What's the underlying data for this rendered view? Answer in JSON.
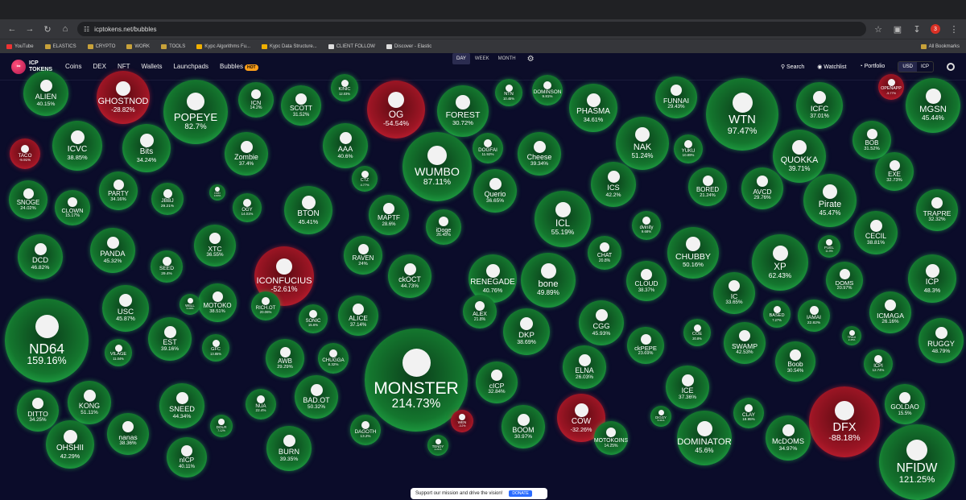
{
  "browser": {
    "url": "icptokens.net/bubbles",
    "bookmarks": [
      "YouTube",
      "ELASTICS",
      "CRYPTO",
      "WORK",
      "TOOLS",
      "Kypc Algorithms Fu...",
      "Kypc Data Structure...",
      "CLIENT FOLLOW",
      "Discover - Elastic"
    ],
    "all_bookmarks": "All Bookmarks",
    "profile_initial": "3"
  },
  "app": {
    "logo_line1": "ICP",
    "logo_line2": "TOKENS",
    "nav": [
      "Coins",
      "DEX",
      "NFT",
      "Wallets",
      "Launchpads",
      "Bubbles"
    ],
    "hot_badge": "HOT",
    "search": "Search",
    "watchlist": "Watchlist",
    "portfolio": "Portfolio",
    "currencies": [
      "USD",
      "ICP"
    ],
    "selected_currency": "USD"
  },
  "period": {
    "options": [
      "DAY",
      "WEEK",
      "MONTH"
    ],
    "selected": "DAY"
  },
  "colors": {
    "positive": "#2bd15a",
    "negative": "#e0283a",
    "background": "#0b0c2a"
  },
  "bubbles": [
    {
      "name": "ALIEN",
      "pct": "40.15%",
      "trend": "up"
    },
    {
      "name": "GHOSTNOD",
      "pct": "-28.82%",
      "trend": "down"
    },
    {
      "name": "POPEYE",
      "pct": "82.7%",
      "trend": "up"
    },
    {
      "name": "ICN",
      "pct": "14.2%",
      "trend": "up"
    },
    {
      "name": "SCOTT",
      "pct": "31.52%",
      "trend": "up"
    },
    {
      "name": "KINIC",
      "pct": "12.03%",
      "trend": "up"
    },
    {
      "name": "OG",
      "pct": "-54.54%",
      "trend": "down"
    },
    {
      "name": "FOREST",
      "pct": "30.72%",
      "trend": "up"
    },
    {
      "name": "NTN",
      "pct": "10.45%",
      "trend": "up"
    },
    {
      "name": "DOMINSON",
      "pct": "9.81%",
      "trend": "up"
    },
    {
      "name": "PHASMA",
      "pct": "34.61%",
      "trend": "up"
    },
    {
      "name": "FUNNAI",
      "pct": "29.43%",
      "trend": "up"
    },
    {
      "name": "WTN",
      "pct": "97.47%",
      "trend": "up"
    },
    {
      "name": "ICFC",
      "pct": "37.01%",
      "trend": "up"
    },
    {
      "name": "OPENAPP",
      "pct": "-5.77%",
      "trend": "down"
    },
    {
      "name": "MGSN",
      "pct": "45.44%",
      "trend": "up"
    },
    {
      "name": "TACO",
      "pct": "-9.91%",
      "trend": "down"
    },
    {
      "name": "ICVC",
      "pct": "38.85%",
      "trend": "up"
    },
    {
      "name": "Bits",
      "pct": "34.24%",
      "trend": "up"
    },
    {
      "name": "Zombie",
      "pct": "37.4%",
      "trend": "up"
    },
    {
      "name": "AAA",
      "pct": "40.6%",
      "trend": "up"
    },
    {
      "name": "WUMBO",
      "pct": "87.11%",
      "trend": "up"
    },
    {
      "name": "DOGFAI",
      "pct": "11.92%",
      "trend": "up"
    },
    {
      "name": "Cheese",
      "pct": "39.34%",
      "trend": "up"
    },
    {
      "name": "NAK",
      "pct": "51.24%",
      "trend": "up"
    },
    {
      "name": "YUKU",
      "pct": "10.89%",
      "trend": "up"
    },
    {
      "name": "BOB",
      "pct": "31.52%",
      "trend": "up"
    },
    {
      "name": "QUOKKA",
      "pct": "39.71%",
      "trend": "up"
    },
    {
      "name": "EXE",
      "pct": "32.73%",
      "trend": "up"
    },
    {
      "name": "SNOGE",
      "pct": "24.02%",
      "trend": "up"
    },
    {
      "name": "CLOWN",
      "pct": "15.17%",
      "trend": "up"
    },
    {
      "name": "PARTY",
      "pct": "34.16%",
      "trend": "up"
    },
    {
      "name": "JBBJ",
      "pct": "29.21%",
      "trend": "up"
    },
    {
      "name": "OGY",
      "pct": "14.01%",
      "trend": "up"
    },
    {
      "name": "BTON",
      "pct": "45.41%",
      "trend": "up"
    },
    {
      "name": "CTZ",
      "pct": "4.77%",
      "trend": "up"
    },
    {
      "name": "Querio",
      "pct": "36.65%",
      "trend": "up"
    },
    {
      "name": "ICS",
      "pct": "42.2%",
      "trend": "up"
    },
    {
      "name": "BORED",
      "pct": "21.24%",
      "trend": "up"
    },
    {
      "name": "AVCD",
      "pct": "29.76%",
      "trend": "up"
    },
    {
      "name": "Pirate",
      "pct": "45.47%",
      "trend": "up"
    },
    {
      "name": "TRAPRE",
      "pct": "32.32%",
      "trend": "up"
    },
    {
      "name": "DCD",
      "pct": "46.82%",
      "trend": "up"
    },
    {
      "name": "PANDA",
      "pct": "45.32%",
      "trend": "up"
    },
    {
      "name": "XTC",
      "pct": "36.55%",
      "trend": "up"
    },
    {
      "name": "SEED",
      "pct": "29.4%",
      "trend": "up"
    },
    {
      "name": "MAPTF",
      "pct": "28.6%",
      "trend": "up"
    },
    {
      "name": "iDoge",
      "pct": "26.45%",
      "trend": "up"
    },
    {
      "name": "ICL",
      "pct": "55.19%",
      "trend": "up"
    },
    {
      "name": "dvinity",
      "pct": "9.68%",
      "trend": "up"
    },
    {
      "name": "CHUBBY",
      "pct": "50.16%",
      "trend": "up"
    },
    {
      "name": "XP",
      "pct": "62.43%",
      "trend": "up"
    },
    {
      "name": "CECIL",
      "pct": "38.81%",
      "trend": "up"
    },
    {
      "name": "ICONFUCIUS",
      "pct": "-52.61%",
      "trend": "down"
    },
    {
      "name": "RAVEN",
      "pct": "24%",
      "trend": "up"
    },
    {
      "name": "ckOCT",
      "pct": "44.73%",
      "trend": "up"
    },
    {
      "name": "RENEGADE",
      "pct": "40.76%",
      "trend": "up"
    },
    {
      "name": "CHAT",
      "pct": "20.8%",
      "trend": "up"
    },
    {
      "name": "FUEL",
      "pct": "11.9%",
      "trend": "up"
    },
    {
      "name": "ICP",
      "pct": "48.3%",
      "trend": "up"
    },
    {
      "name": "ND64",
      "pct": "159.16%",
      "trend": "up"
    },
    {
      "name": "USC",
      "pct": "45.87%",
      "trend": "up"
    },
    {
      "name": "MOTOKO",
      "pct": "38.51%",
      "trend": "up"
    },
    {
      "name": "bone",
      "pct": "49.89%",
      "trend": "up"
    },
    {
      "name": "CLOUD",
      "pct": "38.37%",
      "trend": "up"
    },
    {
      "name": "IC",
      "pct": "33.65%",
      "trend": "up"
    },
    {
      "name": "DOMS",
      "pct": "20.97%",
      "trend": "up"
    },
    {
      "name": "RICH.OT",
      "pct": "20.06%",
      "trend": "up"
    },
    {
      "name": "SONIC",
      "pct": "15.6%",
      "trend": "up"
    },
    {
      "name": "ALICE",
      "pct": "37.14%",
      "trend": "up"
    },
    {
      "name": "ALEX",
      "pct": "21.8%",
      "trend": "up"
    },
    {
      "name": "CGG",
      "pct": "45.93%",
      "trend": "up"
    },
    {
      "name": "BASED",
      "pct": "7.27%",
      "trend": "up"
    },
    {
      "name": "IAMAI",
      "pct": "22.82%",
      "trend": "up"
    },
    {
      "name": "ICMAGA",
      "pct": "26.16%",
      "trend": "up"
    },
    {
      "name": "VILAGE",
      "pct": "11.04%",
      "trend": "up"
    },
    {
      "name": "EST",
      "pct": "39.16%",
      "trend": "up"
    },
    {
      "name": "GFC",
      "pct": "13.85%",
      "trend": "up"
    },
    {
      "name": "AWB",
      "pct": "29.29%",
      "trend": "up"
    },
    {
      "name": "CHUGGA",
      "pct": "8.32%",
      "trend": "up"
    },
    {
      "name": "MONSTER",
      "pct": "214.73%",
      "trend": "up"
    },
    {
      "name": "DKP",
      "pct": "38.69%",
      "trend": "up"
    },
    {
      "name": "ckPEPE",
      "pct": "23.69%",
      "trend": "up"
    },
    {
      "name": "COE",
      "pct": "20.8%",
      "trend": "up"
    },
    {
      "name": "SWAMP",
      "pct": "42.53%",
      "trend": "up"
    },
    {
      "name": "TRAX",
      "pct": "2.45%",
      "trend": "up"
    },
    {
      "name": "RUGGY",
      "pct": "48.79%",
      "trend": "up"
    },
    {
      "name": "DITTO",
      "pct": "34.25%",
      "trend": "up"
    },
    {
      "name": "KONG",
      "pct": "51.11%",
      "trend": "up"
    },
    {
      "name": "SNEED",
      "pct": "44.34%",
      "trend": "up"
    },
    {
      "name": "NUA",
      "pct": "22.4%",
      "trend": "up"
    },
    {
      "name": "BAD.OT",
      "pct": "50.32%",
      "trend": "up"
    },
    {
      "name": "cICP",
      "pct": "32.84%",
      "trend": "up"
    },
    {
      "name": "ELNA",
      "pct": "26.03%",
      "trend": "up"
    },
    {
      "name": "ICE",
      "pct": "37.36%",
      "trend": "up"
    },
    {
      "name": "Boob",
      "pct": "30.54%",
      "trend": "up"
    },
    {
      "name": "ICPI",
      "pct": "12.74%",
      "trend": "up"
    },
    {
      "name": "CLAY",
      "pct": "18.95%",
      "trend": "up"
    },
    {
      "name": "GOLDAO",
      "pct": "15.5%",
      "trend": "up"
    },
    {
      "name": "DOLR",
      "pct": "7.12%",
      "trend": "up"
    },
    {
      "name": "DAGOTH",
      "pct": "13.2%",
      "trend": "up"
    },
    {
      "name": "WEN",
      "pct": "-3.2%",
      "trend": "down"
    },
    {
      "name": "COW",
      "pct": "-32.26%",
      "trend": "down"
    },
    {
      "name": "DIGGY",
      "pct": "6.31%",
      "trend": "up"
    },
    {
      "name": "DFX",
      "pct": "-88.18%",
      "trend": "down"
    },
    {
      "name": "OHSHII",
      "pct": "42.29%",
      "trend": "up"
    },
    {
      "name": "nanas",
      "pct": "38.36%",
      "trend": "up"
    },
    {
      "name": "nICP",
      "pct": "40.11%",
      "trend": "up"
    },
    {
      "name": "BURN",
      "pct": "39.35%",
      "trend": "up"
    },
    {
      "name": "BOOM",
      "pct": "30.97%",
      "trend": "up"
    },
    {
      "name": "MOTOKOINS",
      "pct": "14.25%",
      "trend": "up"
    },
    {
      "name": "DOMINATOR",
      "pct": "45.6%",
      "trend": "up"
    },
    {
      "name": "McDOMS",
      "pct": "34.97%",
      "trend": "up"
    },
    {
      "name": "NFIDW",
      "pct": "121.25%",
      "trend": "up"
    },
    {
      "name": "TENDY",
      "pct": "2.21%",
      "trend": "up"
    },
    {
      "name": "WELL",
      "pct": "6.09%",
      "trend": "up"
    },
    {
      "name": "DOD",
      "pct": "3.83%",
      "trend": "up"
    }
  ],
  "toast": {
    "text": "Support our mission and drive the vision!",
    "button": "DONATE"
  }
}
